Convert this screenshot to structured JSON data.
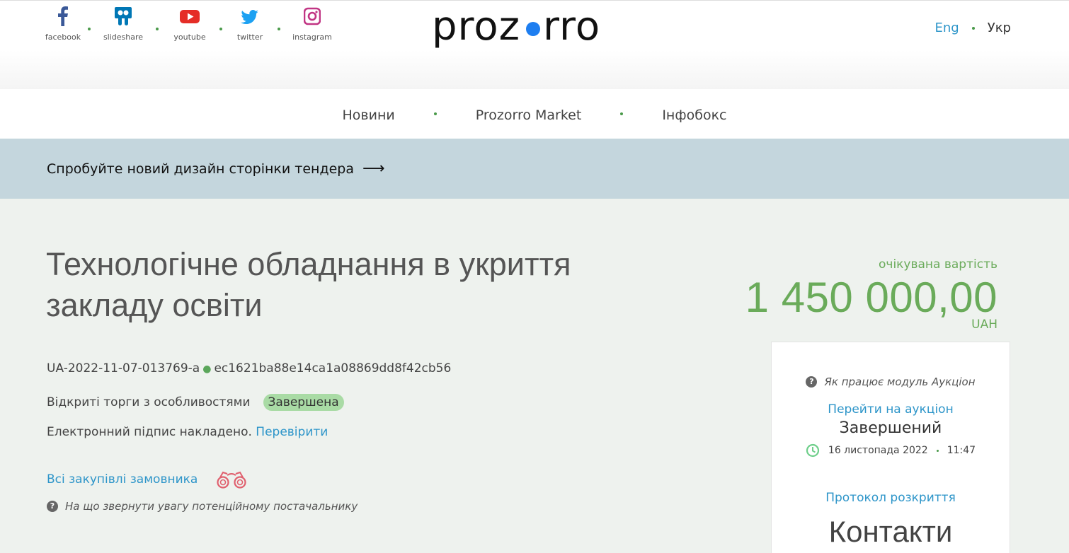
{
  "social": [
    {
      "label": "facebook",
      "icon": "facebook-icon",
      "color": "#3b5998"
    },
    {
      "label": "slideshare",
      "icon": "slideshare-icon",
      "color": "#0077b5"
    },
    {
      "label": "youtube",
      "icon": "youtube-icon",
      "color": "#e52d27"
    },
    {
      "label": "twitter",
      "icon": "twitter-icon",
      "color": "#1da1f2"
    },
    {
      "label": "instagram",
      "icon": "instagram-icon",
      "color": "#c13584"
    }
  ],
  "logo": {
    "left": "proz",
    "right": "rro",
    "dot_color": "#1e7ef0"
  },
  "lang": {
    "eng": "Eng",
    "ukr": "Укр"
  },
  "nav": [
    "Новини",
    "Prozorro Market",
    "Інфобокс"
  ],
  "banner": {
    "text": "Спробуйте новий дизайн сторінки тендера",
    "arrow": "⟶"
  },
  "tender": {
    "title": "Технологічне обладнання в укриття закладу освіти",
    "id": "UA-2022-11-07-013769-a",
    "hash": "ec1621ba88e14ca1a08869dd8f42cb56",
    "procedure": "Відкриті торги з особливостями",
    "status_badge": "Завершена",
    "signature_text": "Електронний підпис накладено.",
    "signature_link": "Перевірити",
    "all_purchases": "Всі закупівлі замовника",
    "hint": "На що звернути увагу потенційному постачальнику"
  },
  "price": {
    "label": "очікувана вартість",
    "value": "1 450 000,00",
    "currency": "UAH"
  },
  "auction": {
    "how": "Як працює модуль Аукціон",
    "goto": "Перейти на аукціон",
    "status": "Завершений",
    "date": "16 листопада 2022",
    "time": "11:47",
    "protocol": "Протокол розкриття",
    "contacts": "Контакти"
  },
  "colors": {
    "accent": "#2d95c9",
    "price": "#6aab5a",
    "badge": "#a9dba5",
    "banner": "#c4d6dd"
  }
}
